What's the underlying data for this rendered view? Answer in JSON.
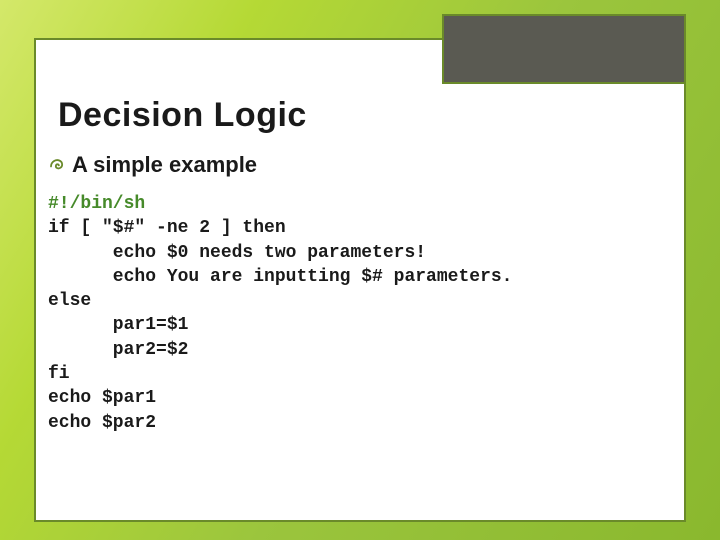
{
  "slide": {
    "title": "Decision Logic",
    "subtitle": "A simple example"
  },
  "code": {
    "shebang": "#!/bin/sh",
    "lines": "if [ \"$#\" -ne 2 ] then\n      echo $0 needs two parameters!\n      echo You are inputting $# parameters.\nelse\n      par1=$1\n      par2=$2\nfi\necho $par1\necho $par2"
  }
}
